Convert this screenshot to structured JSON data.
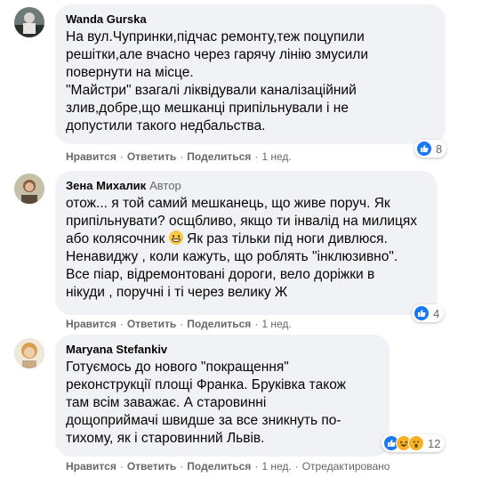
{
  "comments": [
    {
      "author": "Wanda Gurska",
      "badge": "",
      "text": "На вул.Чупринки,підчас ремонту,теж поцупили\nрешітки,але вчасно через гарячу лінію змусили\nповернути на місце.\n\"Майстри\" взагалі ліквідували каналізаційний\nзлив,добре,що мешканці припільнували і не\nдопустили такого недбальства.",
      "actions": [
        "Нравится",
        "Ответить",
        "Поделиться"
      ],
      "time": "1 нед.",
      "reaction_count": "8",
      "reactions": [
        "like-icon"
      ]
    },
    {
      "author": "Зена Михалик",
      "badge": "Автор",
      "text_before_emoji": "отож... я той самий мешканець, що живе поруч. Як\nприпільнувати? осщбливо, якщо ти інвалід на милицях\nабо колясочник ",
      "text_after_emoji": " Як раз тільки під ноги дивлюся.\nНенавиджу , коли кажуть, що роблять \"інклюзивно\".\nВсе піар, відремонтовані дороги, вело доріжки в\nнікуди , поручні і ті через велику Ж",
      "emoji": "grin-emoji",
      "actions": [
        "Нравится",
        "Ответить",
        "Поделиться"
      ],
      "time": "1 нед.",
      "reaction_count": "4",
      "reactions": [
        "like-icon"
      ]
    },
    {
      "author": "Maryana Stefankiv",
      "badge": "",
      "text": "Готуємось до нового \"покращення\"\nреконструкції площі Франка. Бруківка також\nтам всім заважає. А старовинні\nдощоприймачі швидше за все зникнуть по-\nтихому, як і старовинний Львів.",
      "actions": [
        "Нравится",
        "Ответить",
        "Поделиться"
      ],
      "time": "1 нед.",
      "edited": "Отредактировано",
      "reaction_count": "12",
      "reactions": [
        "like-icon",
        "haha-icon",
        "wow-icon"
      ]
    }
  ],
  "colors": {
    "bubble": "#f0f2f5",
    "meta": "#65676b",
    "like": "#1877f2",
    "haha": "#f7b125"
  }
}
